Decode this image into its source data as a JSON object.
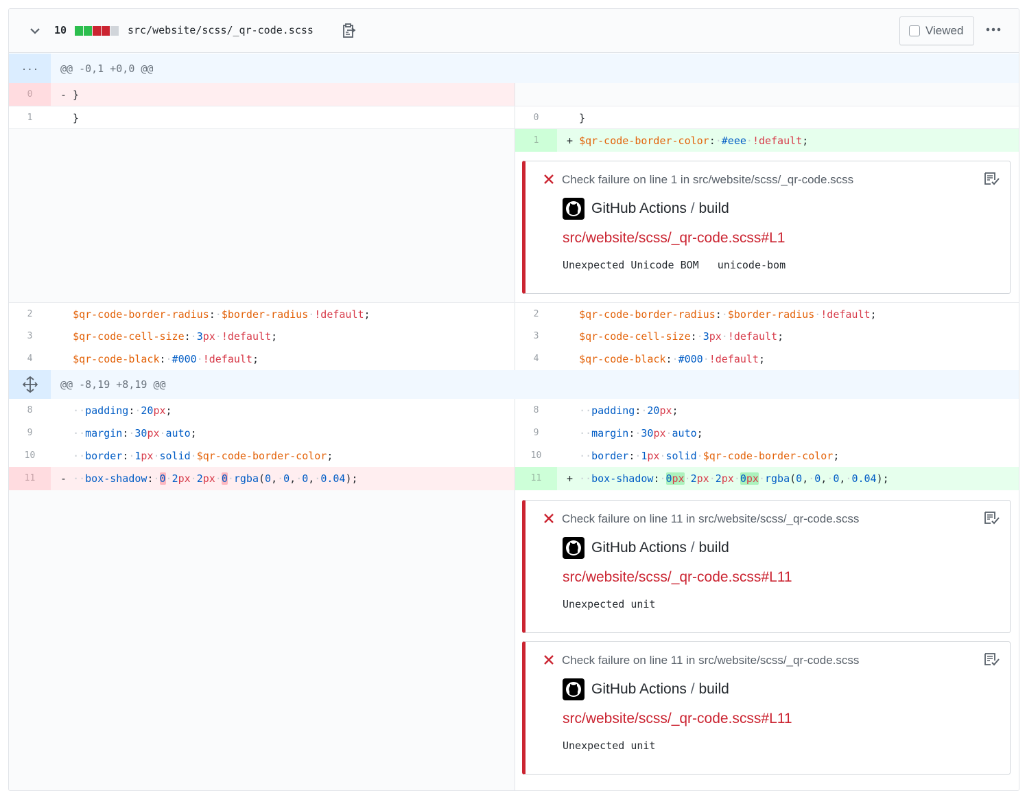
{
  "header": {
    "diffstat_count": "10",
    "diffstat_colors": [
      "#2cbe4e",
      "#2cbe4e",
      "#cb2431",
      "#cb2431",
      "#d1d5da"
    ],
    "file_path": "src/website/scss/_qr-code.scss",
    "viewed_label": "Viewed"
  },
  "hunks": [
    {
      "expander": "...",
      "header": "@@ -0,1 +0,0 @@"
    },
    {
      "expander": "⇕",
      "header": "@@ -8,19 +8,19 @@"
    }
  ],
  "lines": {
    "l0_num": "0",
    "l0_code": "- }",
    "l1_num": "1",
    "l1_code": "  }",
    "r0_num": "0",
    "r0_code": "  }",
    "r1_num": "1",
    "ln2": "2",
    "ln3": "3",
    "ln4": "4",
    "ln8": "8",
    "ln9": "9",
    "ln10": "10",
    "ln11": "11"
  },
  "annotations": [
    {
      "title": "Check failure on line 1 in src/website/scss/_qr-code.scss",
      "app": "GitHub Actions",
      "job": "build",
      "link": "src/website/scss/_qr-code.scss#L1",
      "message": "Unexpected Unicode BOM   unicode-bom"
    },
    {
      "title": "Check failure on line 11 in src/website/scss/_qr-code.scss",
      "app": "GitHub Actions",
      "job": "build",
      "link": "src/website/scss/_qr-code.scss#L11",
      "message": "Unexpected unit"
    },
    {
      "title": "Check failure on line 11 in src/website/scss/_qr-code.scss",
      "app": "GitHub Actions",
      "job": "build",
      "link": "src/website/scss/_qr-code.scss#L11",
      "message": "Unexpected unit"
    }
  ]
}
